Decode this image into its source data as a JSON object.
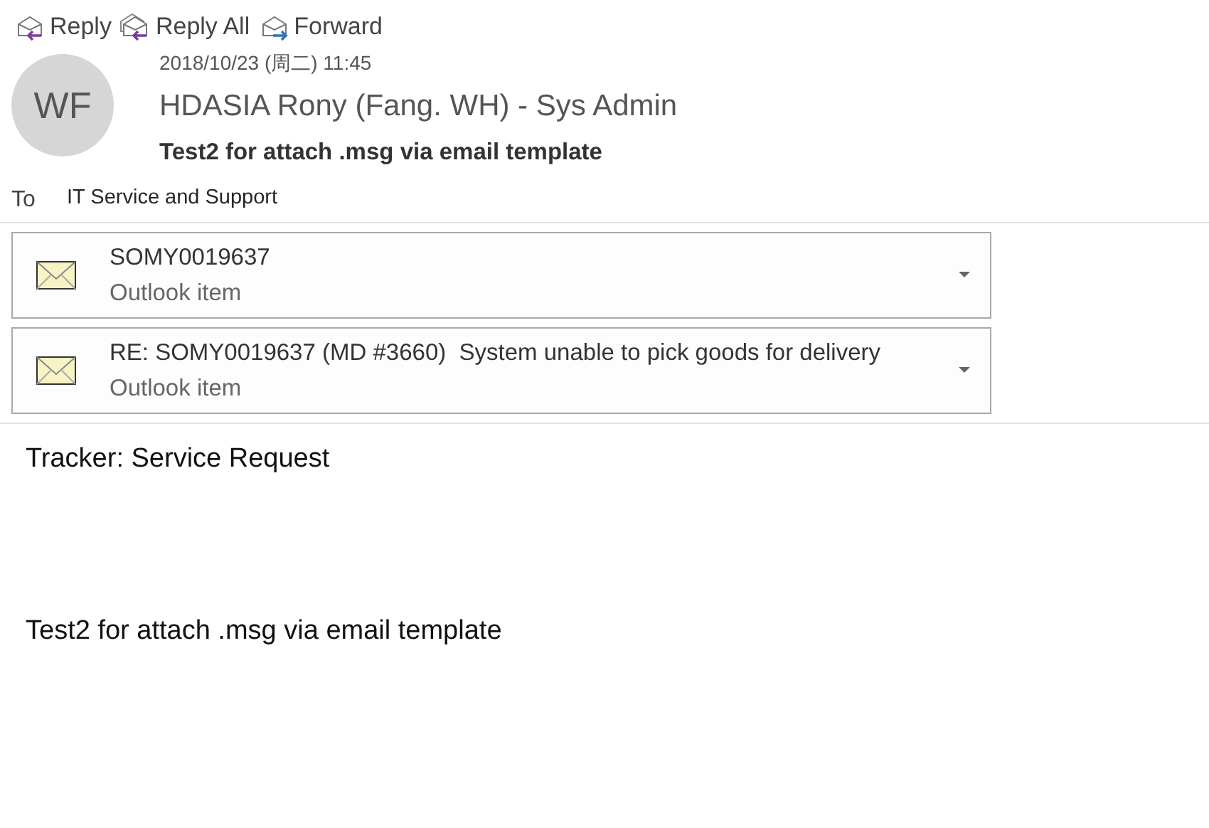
{
  "actions": [
    {
      "kind": "reply",
      "label": "Reply"
    },
    {
      "kind": "reply-all",
      "label": "Reply All"
    },
    {
      "kind": "forward",
      "label": "Forward"
    }
  ],
  "message": {
    "avatar_initials": "WF",
    "date": "2018/10/23 (周二) 11:45",
    "sender": "HDASIA Rony (Fang. WH) - Sys Admin",
    "subject": "Test2 for attach .msg via email template",
    "to_label": "To",
    "to": "IT Service and Support"
  },
  "attachments": [
    {
      "name": "SOMY0019637",
      "type": "Outlook item"
    },
    {
      "name": "RE: SOMY0019637 (MD #3660)  System unable to pick goods for delivery",
      "type": "Outlook item"
    }
  ],
  "body": [
    "Tracker: Service Request",
    "Test2 for attach .msg via email template"
  ]
}
